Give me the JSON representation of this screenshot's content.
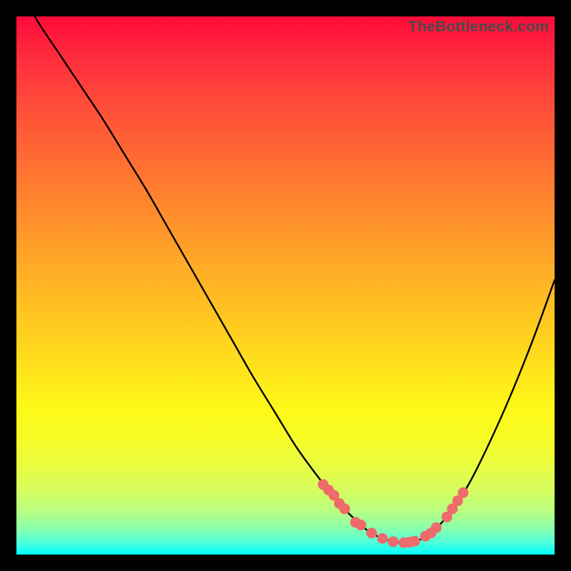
{
  "watermark": "TheBottleneck.com",
  "colors": {
    "page_bg": "#000000",
    "curve": "#000000",
    "marker_fill": "#ef6a6a",
    "marker_stroke": "#e55a5a",
    "gradient_top": "#ff0a3a",
    "gradient_bottom": "#00fff8"
  },
  "chart_data": {
    "type": "line",
    "title": "",
    "xlabel": "",
    "ylabel": "",
    "xlim": [
      0,
      100
    ],
    "ylim": [
      0,
      100
    ],
    "grid": false,
    "legend": false,
    "series": [
      {
        "name": "bottleneck-curve",
        "x": [
          0,
          4,
          8,
          12,
          16,
          20,
          24,
          28,
          32,
          36,
          40,
          44,
          48,
          52,
          56,
          60,
          64,
          66,
          68,
          70,
          72,
          74,
          76,
          80,
          84,
          88,
          92,
          96,
          100
        ],
        "values": [
          106,
          99,
          93,
          87,
          81,
          74.5,
          68,
          61,
          54,
          47,
          40,
          33,
          26.5,
          20,
          14.5,
          9.5,
          5.5,
          4,
          3,
          2.4,
          2.2,
          2.5,
          3.4,
          7,
          13,
          21,
          30,
          40,
          51
        ]
      }
    ],
    "markers": {
      "name": "highlight-points",
      "x": [
        57,
        58,
        59,
        60,
        61,
        63,
        64,
        66,
        68,
        70,
        72,
        73,
        74,
        76,
        77,
        78,
        80,
        81,
        82,
        83
      ],
      "values": [
        13,
        12,
        11,
        9.5,
        8.5,
        6,
        5.5,
        4,
        3,
        2.4,
        2.2,
        2.3,
        2.5,
        3.4,
        4.0,
        5.0,
        7,
        8.5,
        10,
        11.5
      ]
    }
  }
}
